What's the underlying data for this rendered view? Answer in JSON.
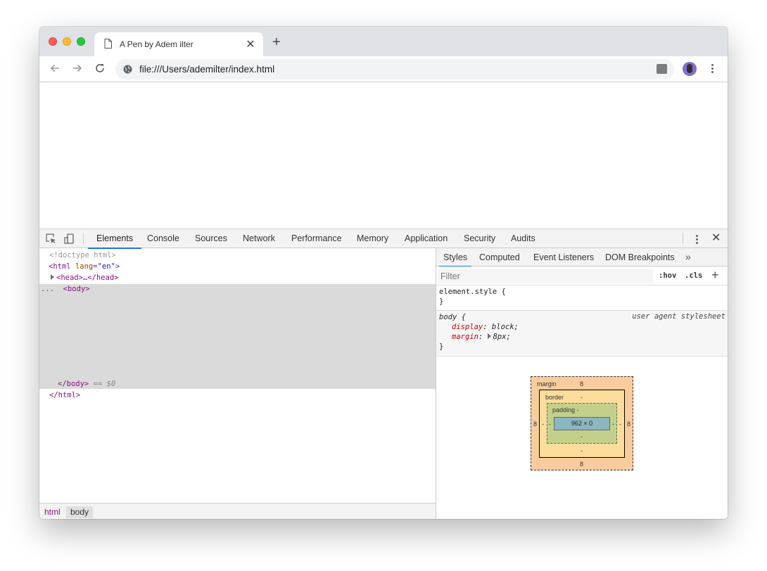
{
  "tab": {
    "title": "A Pen by Adem ilter"
  },
  "omnibox": {
    "url": "file:///Users/ademilter/index.html"
  },
  "devtools": {
    "tabs": [
      "Elements",
      "Console",
      "Sources",
      "Network",
      "Performance",
      "Memory",
      "Application",
      "Security",
      "Audits"
    ],
    "active_tab": "Elements"
  },
  "elements": {
    "doctype": "<!doctype html>",
    "html_open_tag": "<html",
    "html_attr_name": "lang",
    "html_attr_value": "\"en\"",
    "head_collapsed": "<head>…</head>",
    "body_open": "<body>",
    "body_close": "</body>",
    "selected_suffix": "== $0",
    "html_close": "</html>",
    "dots": "..."
  },
  "breadcrumbs": [
    "html",
    "body"
  ],
  "styles_pane": {
    "tabs": [
      "Styles",
      "Computed",
      "Event Listeners",
      "DOM Breakpoints"
    ],
    "active_tab": "Styles",
    "filter_placeholder": "Filter",
    "hov_label": ":hov",
    "cls_label": ".cls",
    "element_style_selector": "element.style {",
    "close_brace": "}",
    "body_rule": {
      "selector": "body {",
      "source": "user agent stylesheet",
      "display_prop": "display",
      "display_value": "block;",
      "margin_prop": "margin",
      "margin_value": "8px;"
    }
  },
  "box_model": {
    "margin_label": "margin",
    "margin_top": "8",
    "margin_bottom": "8",
    "margin_left": "8",
    "margin_right": "8",
    "border_label": "border",
    "border_value": "-",
    "padding_label": "padding -",
    "padding_value": "-",
    "content_size": "962 × 0"
  }
}
